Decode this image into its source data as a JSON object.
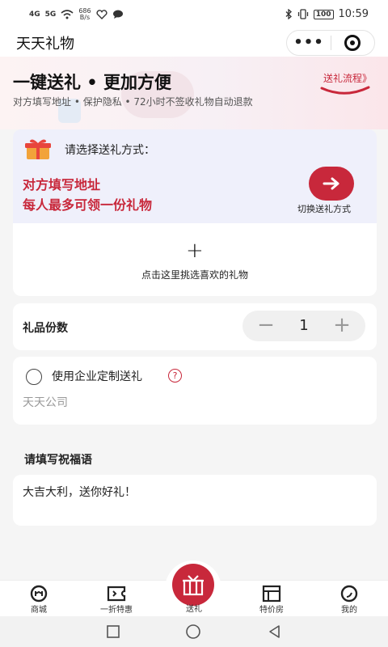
{
  "status_bar": {
    "signal1": "4G",
    "signal2": "5G",
    "speed_value": "686",
    "speed_unit": "B/s",
    "battery": "100",
    "time": "10:59"
  },
  "title_bar": {
    "title": "天天礼物",
    "more_glyph": "•••"
  },
  "banner": {
    "headline": "一键送礼 • 更加方便",
    "subline": "对方填写地址 • 保护隐私 • 72小时不签收礼物自动退款",
    "flow_link": "送礼流程》"
  },
  "gift_mode": {
    "prompt": "请选择送礼方式：",
    "line1": "对方填写地址",
    "line2": "每人最多可领一份礼物",
    "switch_label": "切换送礼方式"
  },
  "gift_picker": {
    "plus": "+",
    "label": "点击这里挑选喜欢的礼物"
  },
  "quantity": {
    "label": "礼品份数",
    "minus": "−",
    "value": "1",
    "plus": "+"
  },
  "enterprise": {
    "label": "使用企业定制送礼",
    "help": "?",
    "company": "天天公司"
  },
  "blessing": {
    "heading": "请填写祝福语",
    "text": "大吉大利，送你好礼！"
  },
  "tabs": [
    {
      "label": "商城",
      "icon": "mall-icon"
    },
    {
      "label": "一折特惠",
      "icon": "coupon-icon"
    },
    {
      "label": "送礼",
      "icon": "gift-icon"
    },
    {
      "label": "特价房",
      "icon": "house-icon"
    },
    {
      "label": "我的",
      "icon": "profile-icon"
    }
  ],
  "colors": {
    "accent": "#c8283b",
    "card_tint": "#eff0fb",
    "background": "#f5f5f5"
  }
}
